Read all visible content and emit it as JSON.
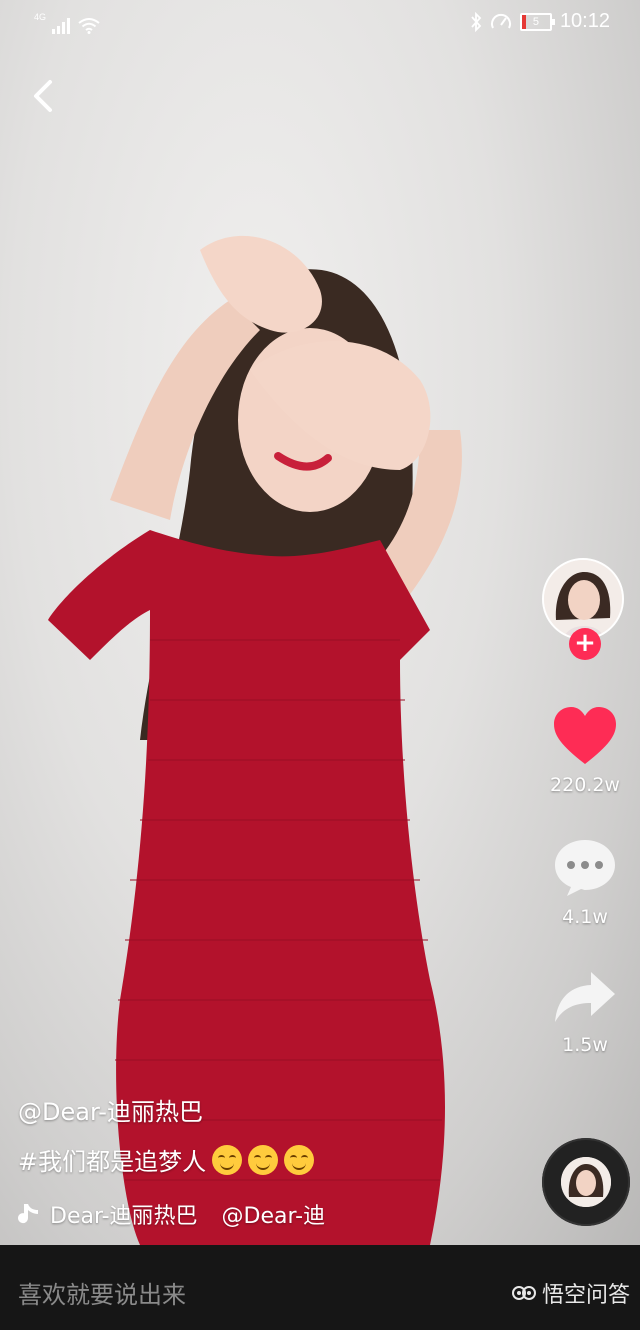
{
  "status_bar": {
    "network": "4G",
    "battery": "5",
    "time": "10:12"
  },
  "video": {
    "author_handle": "@Dear-迪丽热巴",
    "hashtag": "#我们都是追梦人",
    "music_title": "Dear-迪丽热巴",
    "music_author": "@Dear-迪"
  },
  "actions": {
    "likes": "220.2w",
    "comments": "4.1w",
    "shares": "1.5w"
  },
  "comment_bar": {
    "placeholder": "喜欢就要说出来"
  },
  "watermark": {
    "text": "悟空问答"
  },
  "colors": {
    "accent": "#fe2c55",
    "dress": "#b3122c"
  }
}
